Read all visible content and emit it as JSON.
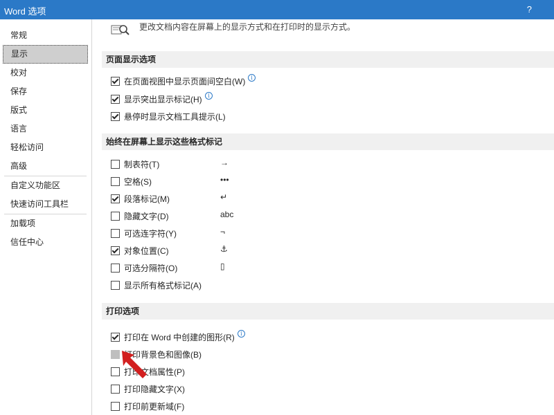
{
  "window": {
    "title": "Word 选项",
    "help": "?"
  },
  "sidebar": {
    "groups": [
      [
        "常规",
        "显示",
        "校对",
        "保存",
        "版式",
        "语言",
        "轻松访问",
        "高级"
      ],
      [
        "自定义功能区",
        "快速访问工具栏"
      ],
      [
        "加载项",
        "信任中心"
      ]
    ],
    "selected": "显示"
  },
  "main": {
    "top_text": "更改文档内容在屏幕上的显示方式和在打印时的显示方式。",
    "sections": [
      {
        "title": "页面显示选项",
        "options": [
          {
            "label": "在页面视图中显示页面间空白(W)",
            "checked": true,
            "info": true
          },
          {
            "label": "显示突出显示标记(H)",
            "checked": true,
            "info": true
          },
          {
            "label": "悬停时显示文档工具提示(L)",
            "checked": true,
            "info": false
          }
        ]
      },
      {
        "title": "始终在屏幕上显示这些格式标记",
        "options": [
          {
            "label": "制表符(T)",
            "checked": false,
            "symbol": "→"
          },
          {
            "label": "空格(S)",
            "checked": false,
            "symbol": "•••"
          },
          {
            "label": "段落标记(M)",
            "checked": true,
            "symbol": "↵"
          },
          {
            "label": "隐藏文字(D)",
            "checked": false,
            "symbol": "abc"
          },
          {
            "label": "可选连字符(Y)",
            "checked": false,
            "symbol": "¬"
          },
          {
            "label": "对象位置(C)",
            "checked": true,
            "symbol": "⚓"
          },
          {
            "label": "可选分隔符(O)",
            "checked": false,
            "symbol": "▯"
          },
          {
            "label": "显示所有格式标记(A)",
            "checked": false,
            "symbol": ""
          }
        ]
      },
      {
        "title": "打印选项",
        "options": [
          {
            "label": "打印在 Word 中创建的图形(R)",
            "checked": true,
            "info": true
          },
          {
            "label": "打印背景色和图像(B)",
            "checked": false,
            "disabled": true
          },
          {
            "label": "打印文档属性(P)",
            "checked": false
          },
          {
            "label": "打印隐藏文字(X)",
            "checked": false
          },
          {
            "label": "打印前更新域(F)",
            "checked": false
          }
        ]
      }
    ]
  },
  "annotation": {
    "color": "#d21f1f",
    "icon": "red-arrow-icon"
  }
}
